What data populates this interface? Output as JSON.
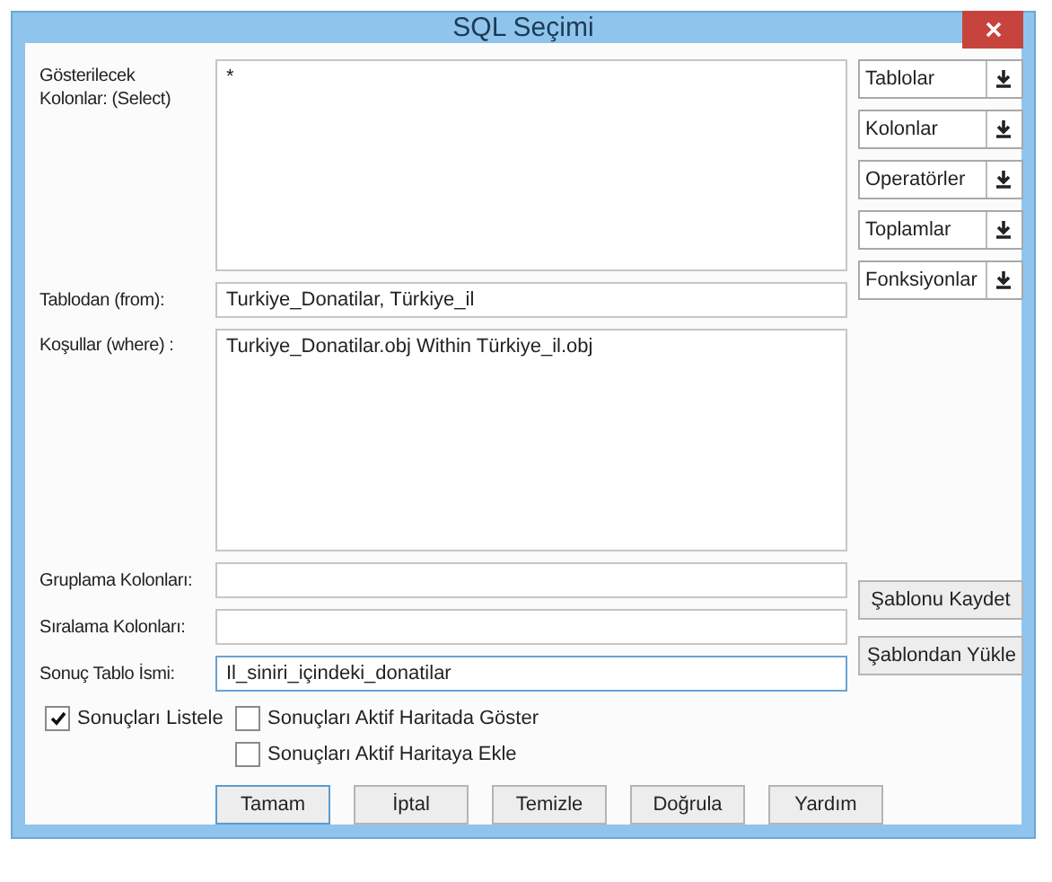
{
  "window": {
    "title": "SQL Seçimi"
  },
  "fields": [
    {
      "label": "Gösterilecek Kolonlar: (Select)",
      "value": "*",
      "kind": "area"
    },
    {
      "label": "Tablodan (from):",
      "value": "Turkiye_Donatilar, Türkiye_il",
      "kind": "line"
    },
    {
      "label": "Koşullar (where) :",
      "value": "Turkiye_Donatilar.obj Within Türkiye_il.obj",
      "kind": "area"
    },
    {
      "label": "Gruplama Kolonları:",
      "kind": "line"
    },
    {
      "label": "Sıralama Kolonları:",
      "kind": "line"
    },
    {
      "label": "Sonuç Tablo İsmi:",
      "value": "Il_siniri_içindeki_donatilar",
      "kind": "line",
      "focused": true
    }
  ],
  "pickers": [
    "Tablolar",
    "Kolonlar",
    "Operatörler",
    "Toplamlar",
    "Fonksiyonlar"
  ],
  "template_buttons": [
    "Şablonu Kaydet",
    "Şablondan Yükle"
  ],
  "checkboxes": [
    {
      "label": "Sonuçları Listele",
      "checked": true
    },
    {
      "label": "Sonuçları Aktif Haritada Göster",
      "checked": false
    },
    {
      "label": "Sonuçları Aktif Haritaya Ekle",
      "checked": false
    }
  ],
  "buttons": [
    {
      "label": "Tamam",
      "selected": true
    },
    {
      "label": "İptal",
      "selected": false
    },
    {
      "label": "Temizle",
      "selected": false
    },
    {
      "label": "Doğrula",
      "selected": false
    },
    {
      "label": "Yardım",
      "selected": false
    }
  ]
}
